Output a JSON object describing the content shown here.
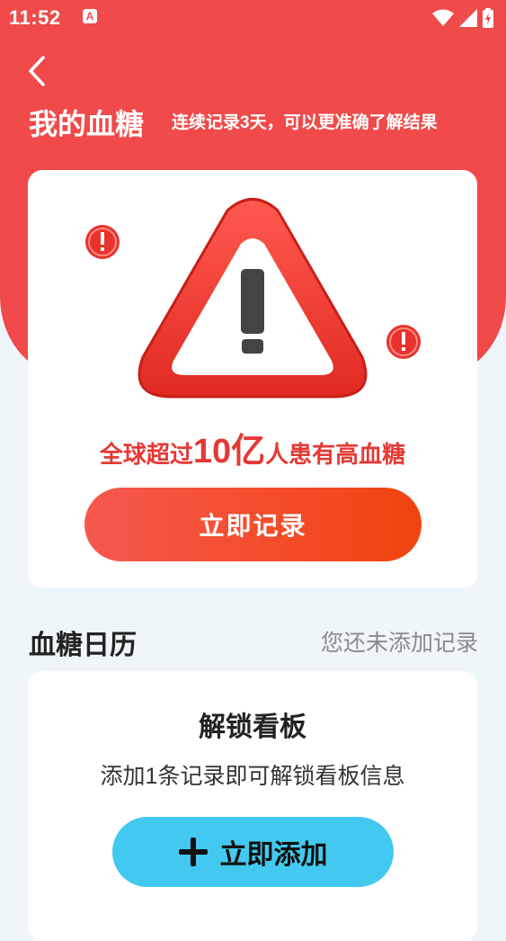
{
  "status_bar": {
    "time": "11:52",
    "app_icon_letter": "A",
    "icons": [
      "wifi-icon",
      "signal-icon",
      "battery-charging-icon"
    ]
  },
  "header": {
    "back_icon": "chevron-left-icon",
    "title": "我的血糖",
    "subtitle": "连续记录3天，可以更准确了解结果"
  },
  "warning_card": {
    "icon": "warning-triangle-icon",
    "text_before": "全球超过",
    "text_number": "10亿",
    "text_after": "人患有高血糖",
    "button_label": "立即记录"
  },
  "calendar": {
    "title": "血糖日历",
    "status": "您还未添加记录"
  },
  "dashboard_card": {
    "title": "解锁看板",
    "description": "添加1条记录即可解锁看板信息",
    "button_label": "立即添加",
    "button_icon": "plus-icon"
  },
  "colors": {
    "header_red": "#f04a4a",
    "warning_red": "#e53935",
    "record_button_gradient": [
      "#f6584f",
      "#f0440d"
    ],
    "add_button_blue": "#43c9ef",
    "page_background": "#eef6f9"
  }
}
